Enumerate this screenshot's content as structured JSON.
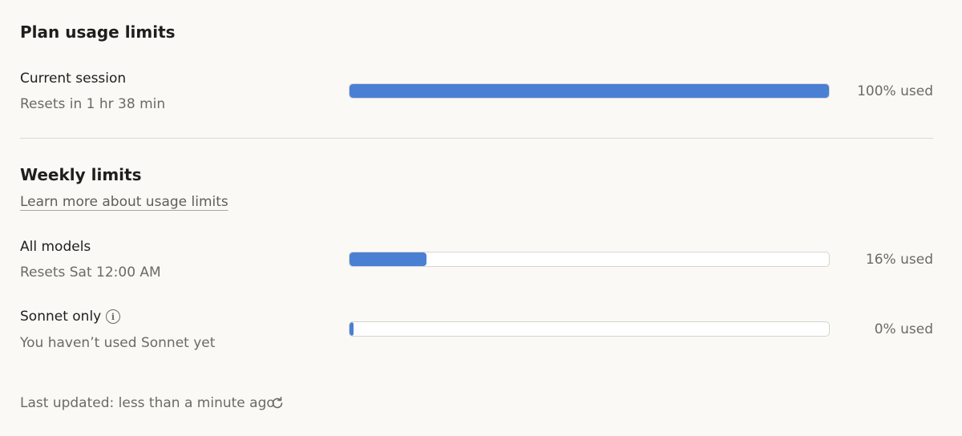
{
  "plan": {
    "title": "Plan usage limits",
    "current_session": {
      "label": "Current session",
      "reset": "Resets in 1 hr 38 min",
      "percent": 100,
      "used_label": "100% used"
    }
  },
  "weekly": {
    "title": "Weekly limits",
    "learn_more": "Learn more about usage limits",
    "all_models": {
      "label": "All models",
      "reset": "Resets Sat 12:00 AM",
      "percent": 16,
      "used_label": "16% used"
    },
    "sonnet": {
      "label": "Sonnet only",
      "info_icon": "info-icon",
      "reset": "You haven’t used Sonnet yet",
      "percent": 0,
      "used_label": "0% used"
    }
  },
  "footer": {
    "last_updated": "Last updated: less than a minute ago",
    "refresh_icon": "refresh-icon"
  },
  "colors": {
    "accent": "#4a80d3",
    "background": "#faf9f6",
    "track": "#ffffff"
  }
}
